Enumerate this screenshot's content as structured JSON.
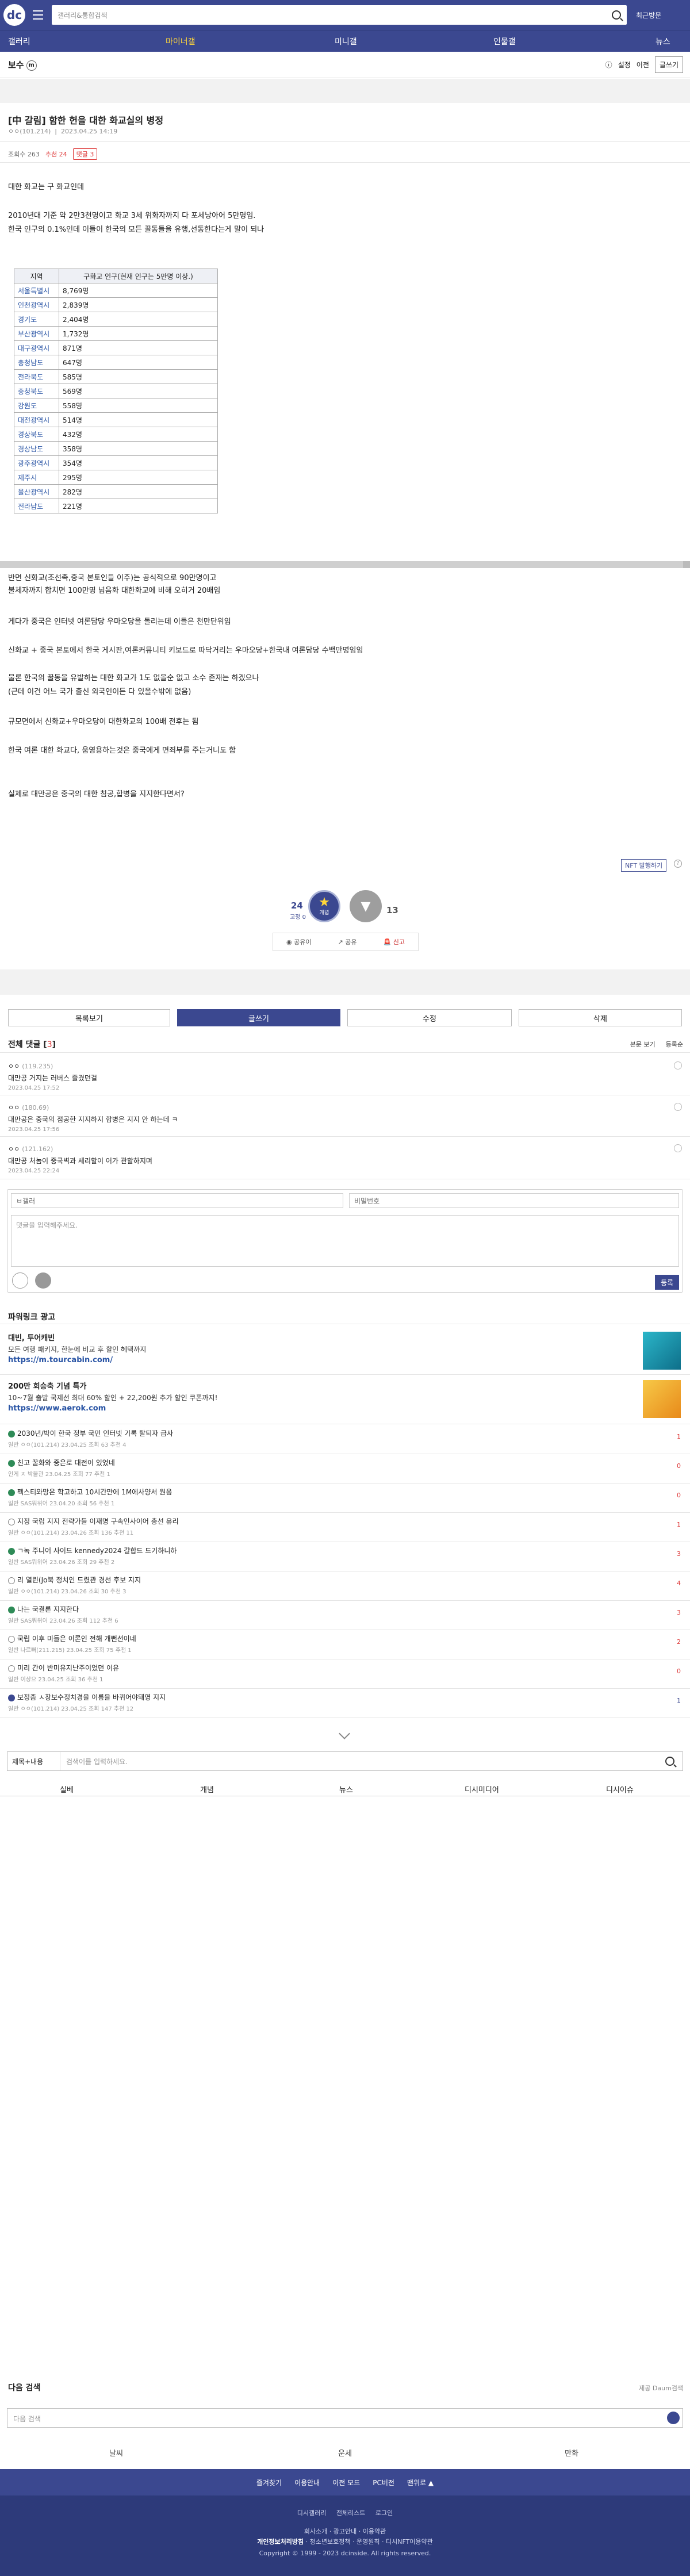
{
  "topbar": {
    "search_placeholder": "갤러리&통합검색",
    "recent_label": "최근방문"
  },
  "nav": [
    "갤러리",
    "마이너갤",
    "미니갤",
    "인물갤",
    "뉴스"
  ],
  "gallery": {
    "name": "보수",
    "badge": "m",
    "options": [
      "설정",
      "이전",
      "글쓰기"
    ]
  },
  "post": {
    "title": "[中 갈림] 함한 헌을 대한 화교실의 병정",
    "author": "ㅇㅇ(101.214)",
    "date": "2023.04.25 14:19",
    "views_label": "조회수 263",
    "reco_label": "추천 24",
    "comment_label": "댓글 3",
    "lines": [
      "대한 화교는 구 화교인데",
      "2010년대 기준 약 2만3천명이고 화교 3세 위화자까지 다 포세낭아어 5만명임.",
      "한국 인구의 0.1%인데 이들이 한국의 모든 꿀동들을 유행,선동한다는게 말이 되나"
    ],
    "table_head": [
      "지역",
      "구화교 인구(현재 인구는 5만명 이상.)"
    ],
    "table_rows": [
      [
        "서울특별시",
        "8,769명"
      ],
      [
        "인천광역시",
        "2,839명"
      ],
      [
        "경기도",
        "2,404명"
      ],
      [
        "부산광역시",
        "1,732명"
      ],
      [
        "대구광역시",
        "871명"
      ],
      [
        "충청남도",
        "647명"
      ],
      [
        "전라북도",
        "585명"
      ],
      [
        "충청북도",
        "569명"
      ],
      [
        "강원도",
        "558명"
      ],
      [
        "대전광역시",
        "514명"
      ],
      [
        "경상북도",
        "432명"
      ],
      [
        "경상남도",
        "358명"
      ],
      [
        "광주광역시",
        "354명"
      ],
      [
        "제주시",
        "295명"
      ],
      [
        "울산광역시",
        "282명"
      ],
      [
        "전라남도",
        "221명"
      ]
    ],
    "lines2": [
      "반면 신화교(조선족,중국 본토인들 이주)는 공식적으로 90만명이고",
      "불체자까지 합치면 100만명 넘음화 대한화교에 비해 오히거 20배임",
      "게다가 중국은 인터넷 여론담당 우마오당을 돌리는데 이들은 천만단위임",
      "신화교 + 중국 본토에서 한국 게시판,여론커뮤니티 키보드로 따닥거리는 우마오당+한국내 여론담당 수백만명임임",
      "물론 한국의 꿀동을 유발하는 대한 화교가 1도 없을순 없고 소수 존재는 하겠으나",
      "(근데 이건 어느 국가 출신 외국인이든 다 있을수밖에 없음)",
      "규모면에서 신화교+우마오당이 대한화교의 100배 전후는 됨",
      "한국 여론 대한 화교다, 움영용하는것은 중국에게 면죄부를 주는거니도 함",
      "실제로 대만공은 중국의 대한 침공,합병을 지지한다면서?"
    ],
    "nft_label": "NFT 발행하기",
    "vote_up": "24",
    "vote_fix": "고정 0",
    "vote_up_caption": "개념",
    "vote_down": "13",
    "share": [
      "공유이",
      "공유",
      "신고"
    ]
  },
  "buttons": [
    "목록보기",
    "글쓰기",
    "수정",
    "삭제"
  ],
  "comments": {
    "title": "전체 댓글",
    "count": "3",
    "tools": [
      "본문 보기",
      "등록순"
    ],
    "items": [
      {
        "nick": "ㅇㅇ",
        "ip": "(119.235)",
        "text": "대만공 거지는 러버스 즐겼던걸",
        "date": "2023.04.25 17:52"
      },
      {
        "nick": "ㅇㅇ",
        "ip": "(180.69)",
        "text": "대만공은 중국의 점공한 지지하지 합병은 지지 안 하는데 ㅋ",
        "date": "2023.04.25 17:56"
      },
      {
        "nick": "ㅇㅇ",
        "ip": "(121.162)",
        "text": "대만공 처놈이 중국벽과 세리할이 어가 관할하지며",
        "date": "2023.04.25 22:24"
      }
    ],
    "form_nick": "ㅂ갤러",
    "form_pw": "비밀번호",
    "form_placeholder": "댓글을 입력해주세요.",
    "form_submit": "등록"
  },
  "ads": {
    "title": "파워링크 광고",
    "items": [
      {
        "title": "대빈, 투어캐빈",
        "desc": "모든 여행 패키지, 한눈에 비교 후 할인 혜택까지",
        "url": "https://m.tourcabin.com/"
      },
      {
        "title": "200만 회승축 기념 특가",
        "desc": "10~7월 출발 국제선 최대 60% 할인 + 22,200원 추가 할인 쿠폰까지!",
        "url": "https://www.aerok.com"
      }
    ]
  },
  "list": [
    {
      "title": "2030년/박이 한국 정부 국민 인터넷 기록 탈퇴자 급사",
      "info": "일반   ㅇㅇ(101.214)   23.04.25   조회 63   추천 4",
      "count": "1",
      "blue": false,
      "icon": "green"
    },
    {
      "title": "친고 꿀화와 중은로 대전이 있었네",
      "info": "인게 ㅊ  박물관   23.04.25   조회 77   추천 1",
      "count": "0",
      "blue": false,
      "icon": "green"
    },
    {
      "title": "펙스티와망은 학고하고 10시간만에 1M에사양서 원음",
      "info": "일반   SAS뭐위어   23.04.20   조회 56   추천 1",
      "count": "0",
      "blue": false,
      "icon": "green"
    },
    {
      "title": "지정 국립 지지 전략가들 이재명 구속인사이어 총선 유리",
      "info": "일반   ㅇㅇ(101.214)   23.04.26   조회 136   추천 11",
      "count": "1",
      "blue": false,
      "icon": "gray"
    },
    {
      "title": "ㄱ녹 주니어 사이드 kennedy2024 갈합드 드기하니하",
      "info": "일반   SAS뭐위어   23.04.26   조회 29   추천 2",
      "count": "3",
      "blue": false,
      "icon": "green"
    },
    {
      "title": "리 열린(Jo북 정치인 드렸관 경선 후보 지지",
      "info": "일반   ㅇㅇ(101.214)   23.04.26   조회 30   추천 3",
      "count": "4",
      "blue": false,
      "icon": "gray"
    },
    {
      "title": "나는 국결론 지지한다",
      "info": "일반   SAS뭐위어   23.04.26   조회 112   추천 6",
      "count": "3",
      "blue": false,
      "icon": "green"
    },
    {
      "title": "국립 이후 미들은 이론인 전해 개뻔선이네",
      "info": "일반   나르뻐(211.215)   23.04.25   조회 75   추천 1",
      "count": "2",
      "blue": false,
      "icon": "gray"
    },
    {
      "title": "미리 간이 반미유지난주이었던 이유",
      "info": "일반   이상으   23.04.25   조회 36   추천 1",
      "count": "0",
      "blue": false,
      "icon": "gray"
    },
    {
      "title": "보정좀 ㅅ창보수정치경을 이름을 바뀌어야돼영 지지",
      "info": "일반   ㅇㅇ(101.214)   23.04.25   조회 147   추천 12",
      "count": "1",
      "blue": true,
      "icon": "gif"
    }
  ],
  "list_search": {
    "select": "제목+내용",
    "placeholder": "검색어를 입력하세요."
  },
  "list_tabs": [
    "실베",
    "개념",
    "뉴스",
    "디시미디어",
    "디시이슈"
  ],
  "hot": {
    "title": "다음 검색",
    "right": "제공 Daum검색",
    "placeholder": "다음 검색"
  },
  "bottom_tabs": [
    "날씨",
    "운세",
    "만화"
  ],
  "footer": {
    "row1": [
      "즐겨찾기",
      "이용안내",
      "이전 모드",
      "PC버전",
      "맨위로 ▲"
    ],
    "row2": [
      "디시갤러리",
      "전체리스트",
      "로그인"
    ],
    "row3": [
      "회사소개",
      "광고안내",
      "이용약관"
    ],
    "row4": [
      "개인정보처리방침",
      "청소년보호정책",
      "운영원칙",
      "디시NFT이용약관"
    ],
    "copyright": "Copyright © 1999 - 2023 dcinside. All rights reserved."
  }
}
